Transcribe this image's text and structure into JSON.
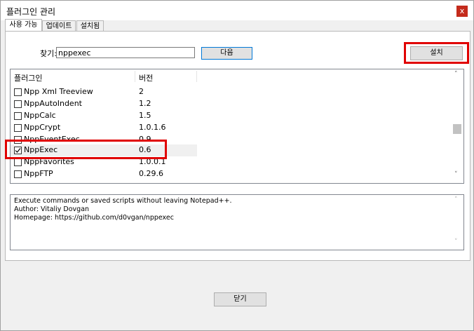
{
  "window": {
    "title": "플러그인 관리",
    "close_glyph": "x"
  },
  "tabs": [
    {
      "label": "사용 가능",
      "active": true
    },
    {
      "label": "업데이트",
      "active": false
    },
    {
      "label": "설치됨",
      "active": false
    }
  ],
  "search": {
    "label": "찾기:",
    "value": "nppexec"
  },
  "buttons": {
    "next": "다음",
    "install": "설치",
    "close": "닫기"
  },
  "list": {
    "columns": [
      "플러그인",
      "버전"
    ],
    "rows": [
      {
        "name": "Npp Xml Treeview",
        "version": "2",
        "checked": false
      },
      {
        "name": "NppAutoIndent",
        "version": "1.2",
        "checked": false
      },
      {
        "name": "NppCalc",
        "version": "1.5",
        "checked": false
      },
      {
        "name": "NppCrypt",
        "version": "1.0.1.6",
        "checked": false
      },
      {
        "name": "NppEventExec",
        "version": "0.9",
        "checked": false
      },
      {
        "name": "NppExec",
        "version": "0.6",
        "checked": true
      },
      {
        "name": "NppFavorites",
        "version": "1.0.0.1",
        "checked": false
      },
      {
        "name": "NppFTP",
        "version": "0.29.6",
        "checked": false
      }
    ],
    "scroll_up_glyph": "˄",
    "scroll_down_glyph": "˅"
  },
  "description": {
    "lines": [
      "Execute commands or saved scripts without leaving Notepad++.",
      "Author: Vitaliy Dovgan",
      "Homepage: https://github.com/d0vgan/nppexec"
    ],
    "scroll_up_glyph": "˄",
    "scroll_down_glyph": "˅"
  },
  "colors": {
    "highlight": "#e00000",
    "close_button": "#c42b1c",
    "focus_border": "#0078d7"
  }
}
